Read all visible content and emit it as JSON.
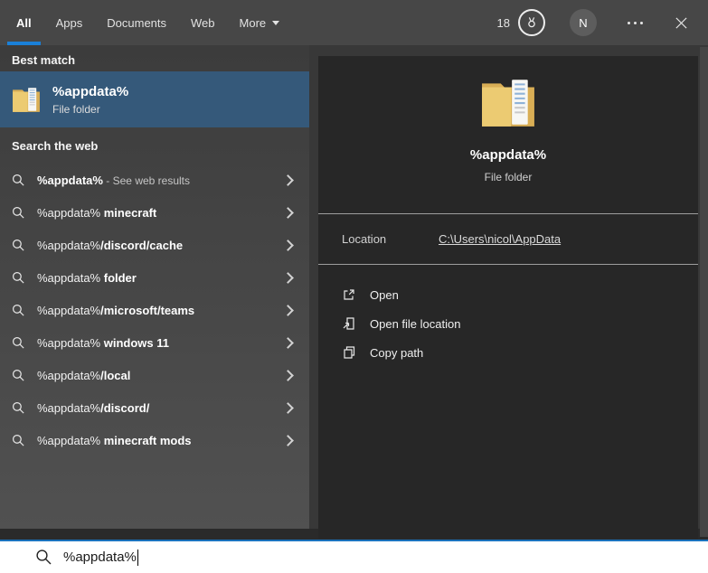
{
  "colors": {
    "accent": "#1a80d8",
    "searchbar_border": "#1a72bc",
    "best_match_highlight": "#35597a",
    "left_panel_bg": "#474747",
    "preview_card_bg": "#272727",
    "folder_yellow": "#eccb72"
  },
  "icons": {
    "search": "magnifier",
    "chevron_right": "›",
    "dropdown_caret": "▾",
    "rewards": "medal",
    "more": "⋯",
    "close": "✕",
    "open": "open-external",
    "open_file_location": "page-arrow",
    "copy_path": "copy-pages",
    "result_folder": "yellow-folder"
  },
  "tabs": [
    {
      "label": "All",
      "selected": true
    },
    {
      "label": "Apps",
      "selected": false
    },
    {
      "label": "Documents",
      "selected": false
    },
    {
      "label": "Web",
      "selected": false
    },
    {
      "label": "More",
      "selected": false,
      "has_dropdown": true
    }
  ],
  "topbar": {
    "rewards_count": "18",
    "avatar_initial": "N"
  },
  "left": {
    "best_match_header": "Best match",
    "best_match": {
      "title": "%appdata%",
      "subtitle": "File folder"
    },
    "search_web_header": "Search the web",
    "suggestions": [
      {
        "pre": "",
        "bold": "%appdata%",
        "note": " - See web results"
      },
      {
        "pre": "%appdata%",
        "bold": " minecraft",
        "note": ""
      },
      {
        "pre": "%appdata%",
        "bold": "/discord/cache",
        "note": ""
      },
      {
        "pre": "%appdata%",
        "bold": " folder",
        "note": ""
      },
      {
        "pre": "%appdata%",
        "bold": "/microsoft/teams",
        "note": ""
      },
      {
        "pre": "%appdata%",
        "bold": " windows 11",
        "note": ""
      },
      {
        "pre": "%appdata%",
        "bold": "/local",
        "note": ""
      },
      {
        "pre": "%appdata%",
        "bold": "/discord/",
        "note": ""
      },
      {
        "pre": "%appdata%",
        "bold": " minecraft mods",
        "note": ""
      }
    ]
  },
  "preview": {
    "title": "%appdata%",
    "subtitle": "File folder",
    "location_label": "Location",
    "location_value": "C:\\Users\\nicol\\AppData",
    "actions": [
      {
        "label": "Open"
      },
      {
        "label": "Open file location"
      },
      {
        "label": "Copy path"
      }
    ]
  },
  "search": {
    "value": "%appdata%",
    "placeholder": ""
  }
}
